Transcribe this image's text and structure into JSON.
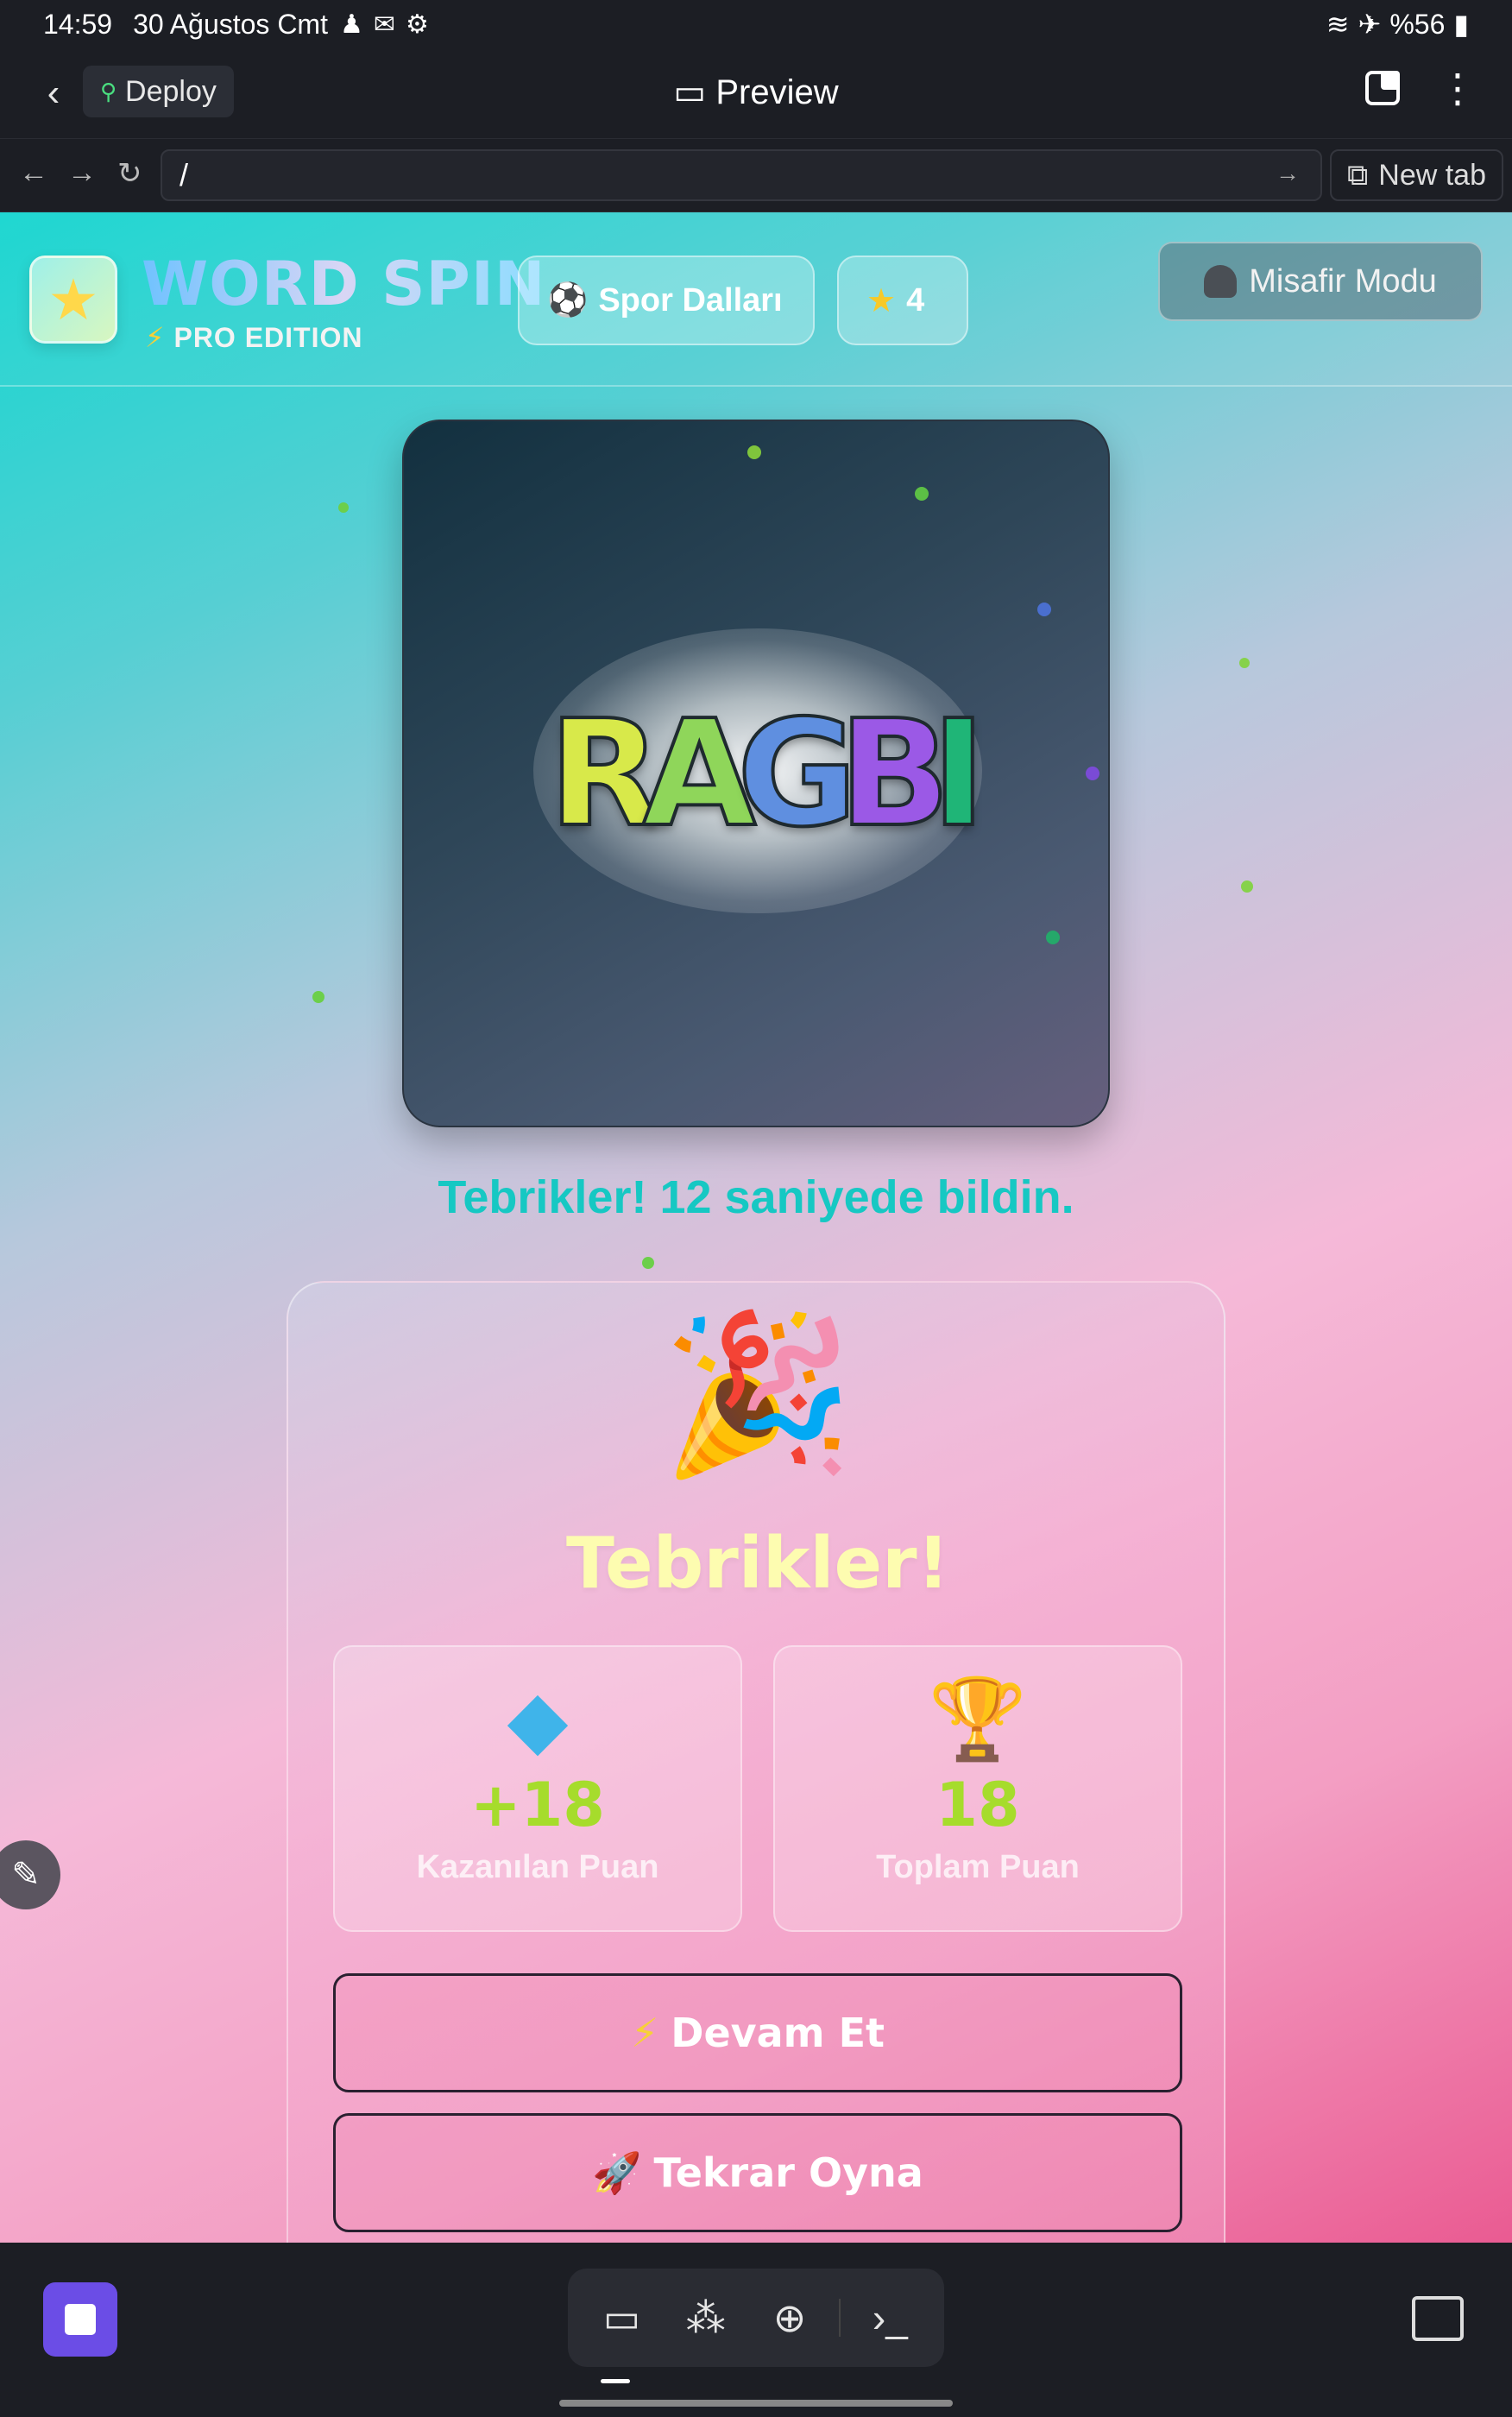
{
  "status_bar": {
    "time": "14:59",
    "date": "30 Ağustos Cmt",
    "battery": "%56"
  },
  "app_bar": {
    "deploy_label": "Deploy",
    "title": "Preview"
  },
  "url_bar": {
    "value": "/",
    "new_tab_label": "New tab"
  },
  "game": {
    "brand_title": "WORD SPIN",
    "brand_subtitle": "PRO EDITION",
    "category_label": "Spor Dalları",
    "stars_count": "4",
    "guest_label": "Misafir Modu",
    "puzzle_letters": [
      "R",
      "A",
      "G",
      "B",
      "I"
    ],
    "letter_colors": [
      "#d8e94a",
      "#8fd65a",
      "#5f8fe0",
      "#9b59e6",
      "#1fb577"
    ],
    "result_message": "Tebrikler! 12 saniyede bildin.",
    "card_title": "Tebrikler!",
    "earned_points": "+18",
    "earned_label": "Kazanılan Puan",
    "total_points": "18",
    "total_label": "Toplam Puan",
    "continue_label": "Devam Et",
    "replay_label": "Tekrar Oyna"
  },
  "icons": {
    "back": "chevron-left-icon",
    "deploy": "deploy-icon",
    "preview": "monitor-icon",
    "tabs": "tabs-icon",
    "more": "kebab-icon",
    "soccer": "soccer-ball-icon",
    "star": "star-icon",
    "guest": "person-icon",
    "party": "party-popper-icon",
    "diamond": "gem-icon",
    "trophy": "trophy-icon",
    "bolt": "lightning-icon",
    "rocket": "rocket-icon",
    "edit": "pencil-icon"
  }
}
